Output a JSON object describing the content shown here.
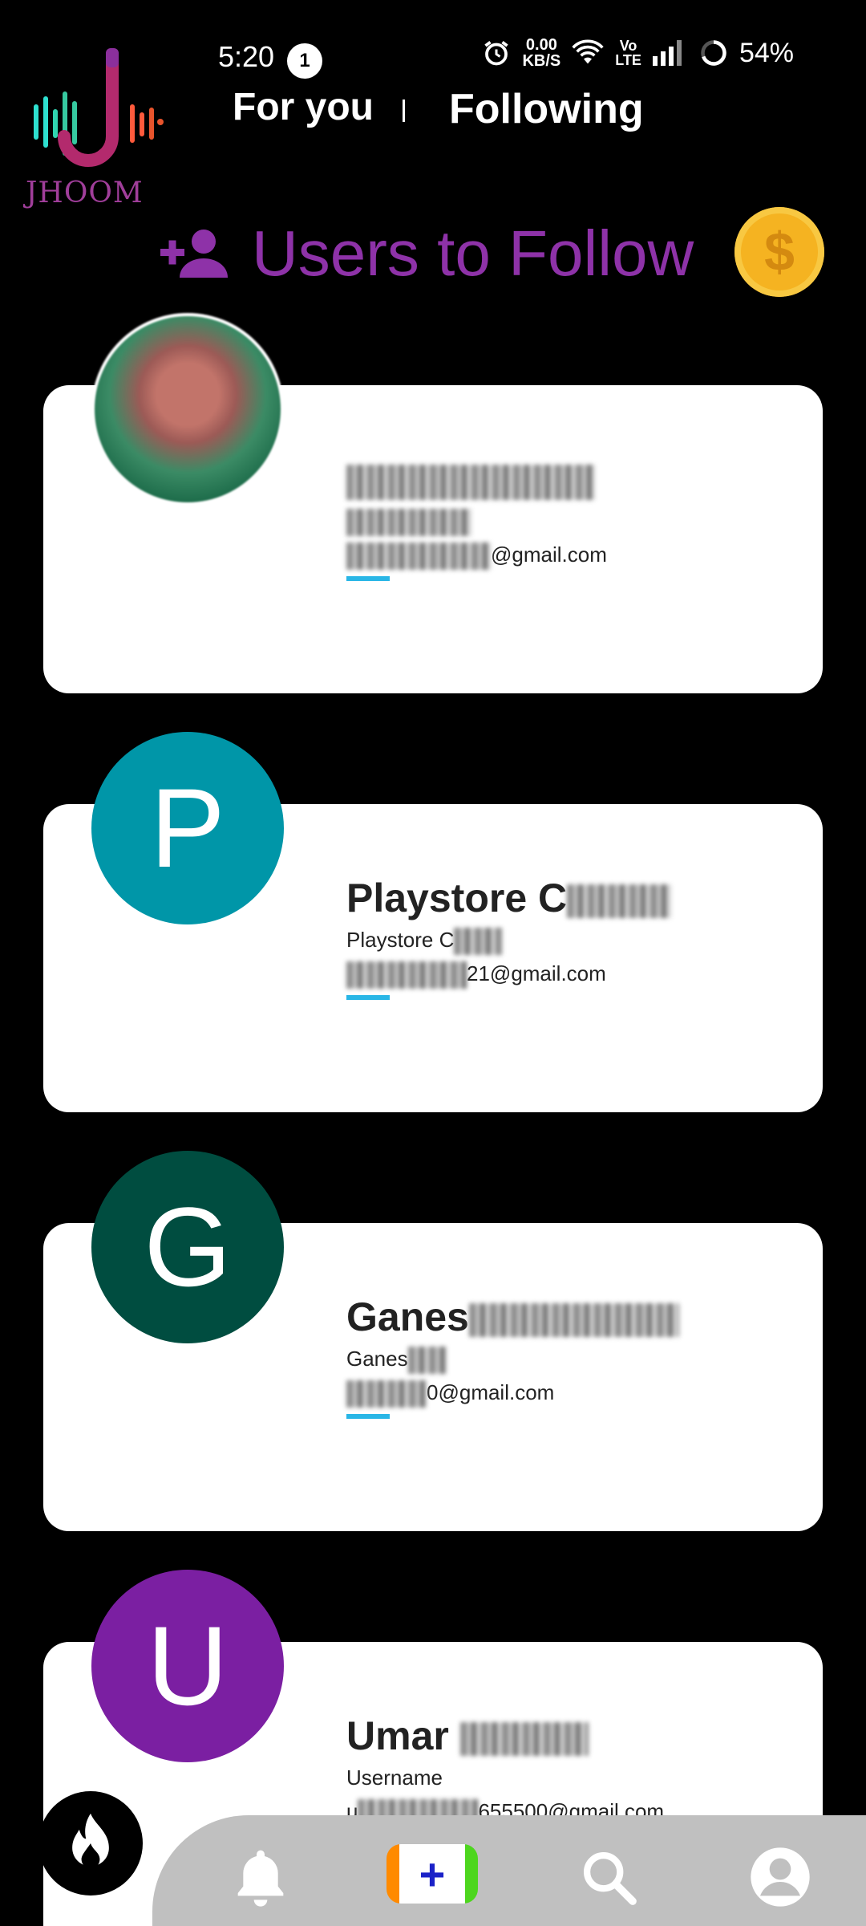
{
  "status": {
    "time": "5:20",
    "notification_count": "1",
    "net_speed_value": "0.00",
    "net_speed_unit": "KB/S",
    "volte_top": "Vo",
    "volte_bottom": "LTE",
    "battery": "54%"
  },
  "app": {
    "logo_text": "JHOOM"
  },
  "tabs": {
    "for_you": "For you",
    "following": "Following"
  },
  "heading": {
    "title": "Users to Follow"
  },
  "cards": [
    {
      "name": "",
      "subtitle": "",
      "email_suffix": "@gmail.com",
      "avatar_letter": "",
      "avatar_color": "photo"
    },
    {
      "name": "Playstore C",
      "subtitle": "Playstore C",
      "email_suffix": "21@gmail.com",
      "avatar_letter": "P",
      "avatar_color": "#0096a8"
    },
    {
      "name": "Ganes",
      "subtitle": "Ganes",
      "email_suffix": "0@gmail.com",
      "avatar_letter": "G",
      "avatar_color": "#004d40"
    },
    {
      "name": "Umar",
      "subtitle": "Username",
      "email_prefix": "u",
      "email_suffix": "655500@gmail.com",
      "avatar_letter": "U",
      "avatar_color": "#7b1fa2"
    }
  ],
  "colors": {
    "accent_purple": "#8e32a8",
    "line_blue": "#29b6e6",
    "bar_gray": "#c0c0c0"
  }
}
